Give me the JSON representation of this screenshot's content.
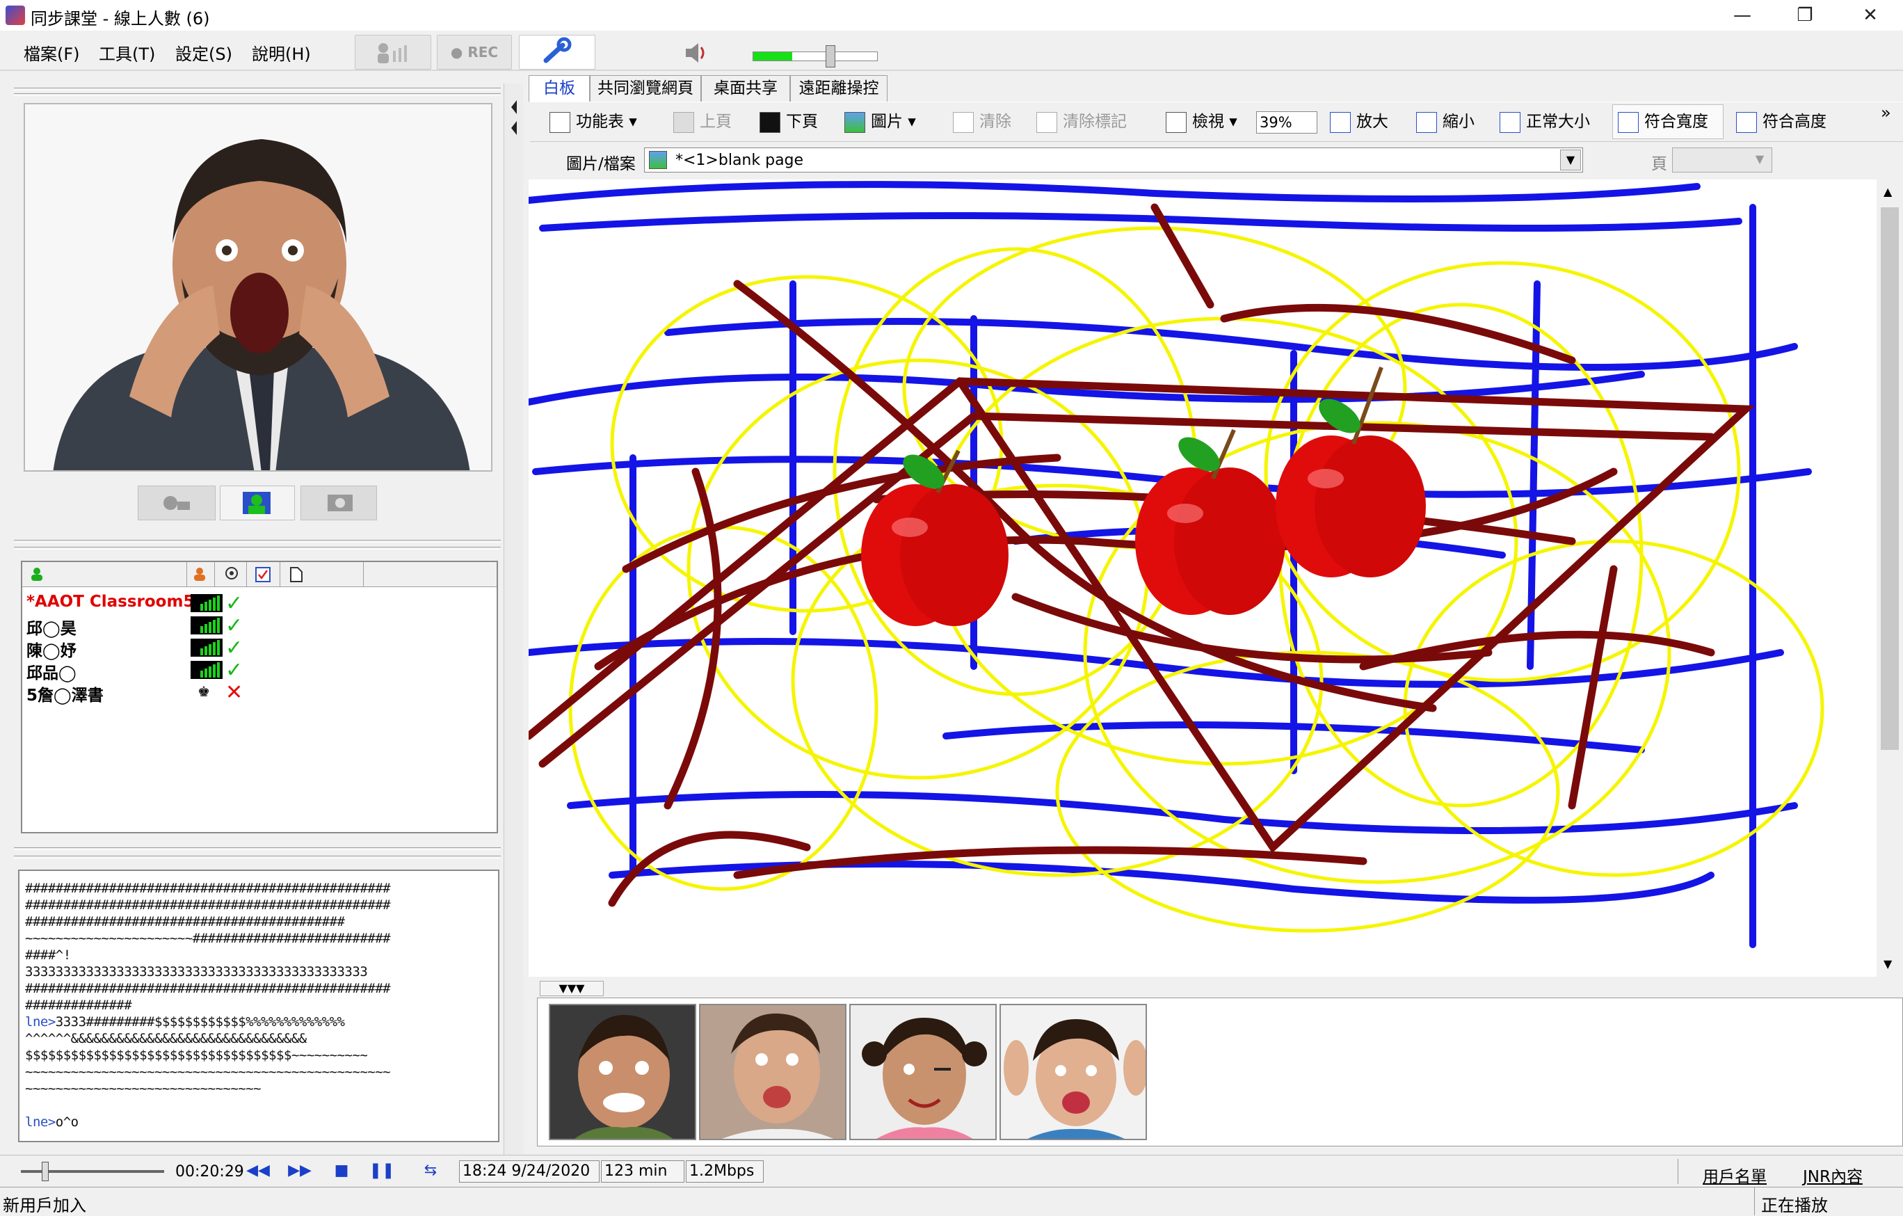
{
  "window": {
    "title": "同步課堂 - 線上人數 (6)",
    "min": "—",
    "restore": "❐",
    "close": "✕"
  },
  "menu": [
    "檔案(F)",
    "工具(T)",
    "設定(S)",
    "說明(H)"
  ],
  "toolbar_top": {
    "rec": "● REC"
  },
  "tabs": [
    "白板",
    "共同瀏覽網頁",
    "桌面共享",
    "遠距離操控"
  ],
  "wb_tools": {
    "menu": "功能表",
    "prev": "上頁",
    "next": "下頁",
    "image": "圖片",
    "clear": "清除",
    "clear_marks": "清除標記",
    "view": "檢視",
    "zoom": "39%",
    "zoom_in": "放大",
    "zoom_out": "縮小",
    "normal": "正常大小",
    "fit_width": "符合寬度",
    "fit_height": "符合高度"
  },
  "file_row": {
    "label": "圖片/檔案",
    "value": "*<1>blank page",
    "page_label": "頁"
  },
  "users": [
    {
      "name": "*AAOT Classroom5",
      "color": "#e00000",
      "status": "✓"
    },
    {
      "name": "邱◯昊",
      "color": "#000",
      "status": "✓"
    },
    {
      "name": "陳◯妤",
      "color": "#000",
      "status": "✓"
    },
    {
      "name": "邱品◯",
      "color": "#000",
      "status": "✓"
    },
    {
      "name": "5詹◯澤書",
      "color": "#000",
      "status": "✕"
    }
  ],
  "chat": [
    "################################################",
    "################################################",
    "##########################################",
    "~~~~~~~~~~~~~~~~~~~~~~##########################",
    "####^!",
    "333333333333333333333333333333333333333333333",
    "################################################",
    "##############",
    "lne>3333#########$$$$$$$$$$$$%%%%%%%%%%%%%",
    "^^^^^^&&&&&&&&&&&&&&&&&&&&&&&&&&&&&&&",
    "$$$$$$$$$$$$$$$$$$$$$$$$$$$$$$$$$$$~~~~~~~~~~",
    "~~~~~~~~~~~~~~~~~~~~~~~~~~~~~~~~~~~~~~~~~~~~~~~~",
    "~~~~~~~~~~~~~~~~~~~~~~~~~~~~~~~",
    "",
    "lne>o^o"
  ],
  "playback": {
    "elapsed": "00:20:29",
    "datetime": "18:24 9/24/2020",
    "duration": "123 min",
    "rate": "1.2Mbps",
    "roster": "用戶名單",
    "jnr": "JNR內容"
  },
  "status": {
    "left": "新用戶加入",
    "right": "正在播放"
  },
  "thumb_toggle": "▼▼▼"
}
